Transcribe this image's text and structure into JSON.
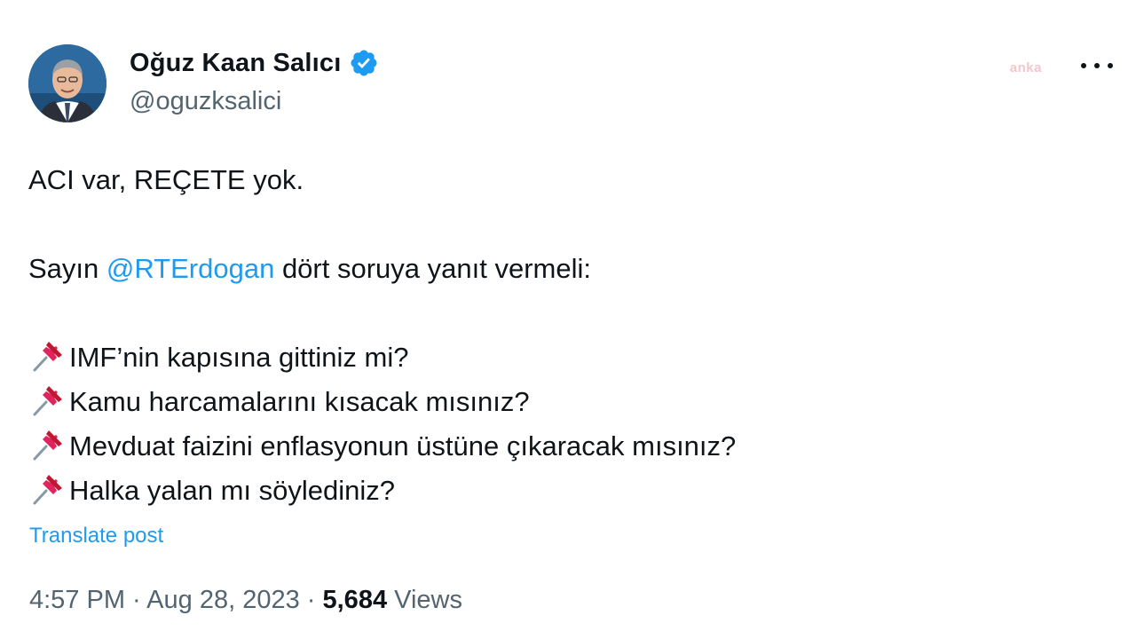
{
  "tweet": {
    "author": {
      "display_name": "Oğuz Kaan Salıcı",
      "handle": "@oguzksalici",
      "verified": true,
      "avatar": "profile-photo"
    },
    "watermark": "anka",
    "lines": {
      "l1": "ACI var, REÇETE yok.",
      "l2_prefix": "Sayın ",
      "l2_mention": "@RTErdogan",
      "l2_suffix": " dört soruya yanıt vermeli:",
      "q1": "IMF’nin kapısına gittiniz mi?",
      "q2": "Kamu harcamalarını kısacak mısınız?",
      "q3": "Mevduat faizini enflasyonun üstüne çıkaracak mısınız?",
      "q4": "Halka yalan mı söylediniz?"
    },
    "translate_label": "Translate post",
    "time": "4:57 PM",
    "separator": " · ",
    "date": "Aug 28, 2023",
    "views_count": "5,684",
    "views_label": " Views"
  },
  "icons": {
    "verified": "verified-badge-icon",
    "more": "more-horizontal-icon",
    "bullet": "pushpin-icon"
  },
  "colors": {
    "link": "#1d9bf0",
    "secondary_text": "#536471",
    "primary_text": "#0f1419",
    "pin": "#e0245e"
  }
}
